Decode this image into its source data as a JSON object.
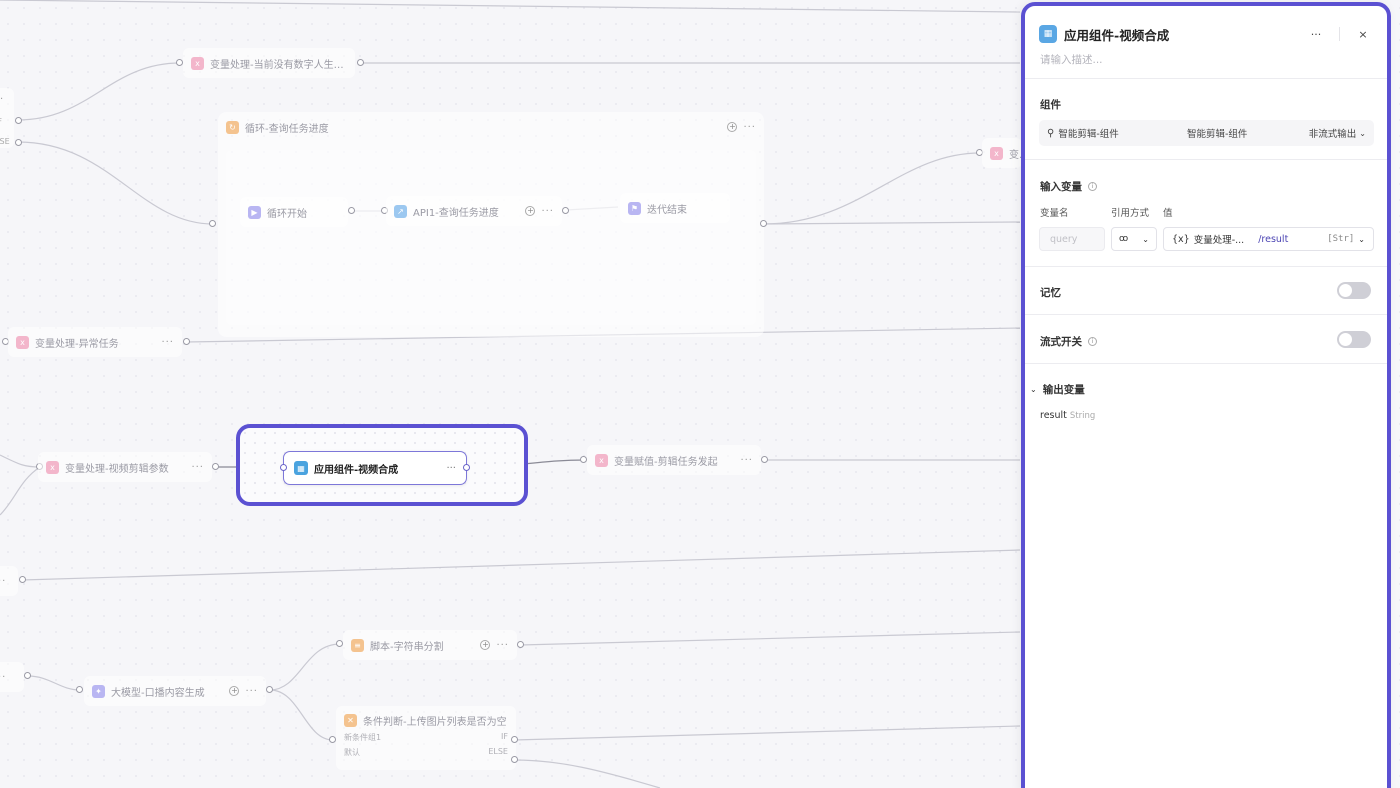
{
  "canvas": {
    "partial_node_labels": [
      "IF",
      "ELSE"
    ],
    "nodes": {
      "var_no_digital_human": "变量处理-当前没有数字人生成...",
      "loop_query_progress": "循环-查询任务进度",
      "loop_start": "循环开始",
      "api_query_progress": "API1-查询任务进度",
      "iter_end": "迭代结束",
      "var_partial_right": "变量",
      "var_exception": "变量处理-异常任务",
      "var_video_params": "变量处理-视频剪辑参数",
      "selected_app_component": "应用组件-视频合成",
      "var_assign_clip_task": "变量赋值-剪辑任务发起",
      "script_string_split": "脚本-字符串分割",
      "llm_narration": "大模型-口播内容生成",
      "cond_upload_images": "条件判断-上传图片列表是否为空",
      "cond_branch_1": "新条件组1",
      "cond_branch_1_tag": "IF",
      "cond_default": "默认",
      "cond_default_tag": "ELSE"
    },
    "more_glyph": "···"
  },
  "panel": {
    "title": "应用组件-视频合成",
    "description_placeholder": "请输入描述...",
    "more_label": "···",
    "close_label": "×",
    "component": {
      "section_title": "组件",
      "name": "智能剪辑-组件",
      "value": "智能剪辑-组件",
      "output_mode": "非流式输出"
    },
    "inputs": {
      "section_title": "输入变量",
      "col_name": "变量名",
      "col_ref": "引用方式",
      "col_value": "值",
      "var_name_placeholder": "query",
      "ref_symbol": "ꝏ",
      "value_prefix": "{x}",
      "value_source": "变量处理-...",
      "value_path": "/result",
      "value_type": "[Str]"
    },
    "memory": {
      "label": "记忆",
      "enabled": false
    },
    "streaming": {
      "label": "流式开关",
      "enabled": false
    },
    "outputs": {
      "section_title": "输出变量",
      "var_name": "result",
      "var_type": "String"
    }
  },
  "colors": {
    "selection": "#5b51d2",
    "accent_path": "#4b44b3",
    "variable_icon": "#f3b6cb",
    "loop_icon": "#f4c38f",
    "api_icon": "#9cc8f0",
    "llm_icon": "#b9b6f2"
  }
}
